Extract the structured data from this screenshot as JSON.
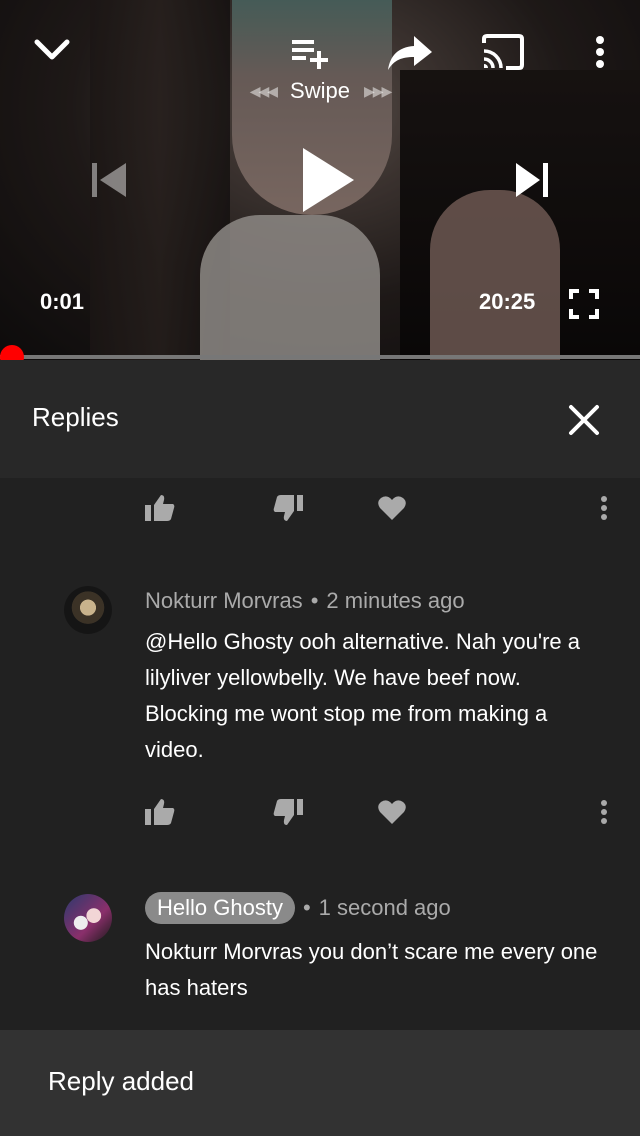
{
  "player": {
    "swipe_label": "Swipe",
    "current_time": "0:01",
    "duration": "20:25",
    "progress": 0.0008,
    "icons": [
      "chevron-down-icon",
      "add-to-queue-icon",
      "share-icon",
      "cast-icon",
      "more-vert-icon",
      "skip-previous-icon",
      "play-icon",
      "skip-next-icon",
      "fullscreen-icon"
    ]
  },
  "replies_panel": {
    "title": "Replies"
  },
  "replies": [
    {
      "author": "Nokturr Morvras",
      "separator": "•",
      "time": "2 minutes ago",
      "text": "@Hello Ghosty ooh alternative. Nah you're a lilyliver yellowbelly. We have beef now. Blocking me wont stop me from making a video."
    },
    {
      "author": "Hello Ghosty",
      "separator": "•",
      "time": "1 second ago",
      "text": "Nokturr Morvras you don’t scare me  every one has haters"
    }
  ],
  "snackbar": {
    "message": "Reply added"
  },
  "colors": {
    "background": "#212121",
    "header": "#282828",
    "progress_accent": "#ff0000",
    "snackbar": "#323232",
    "chip": "#8a8a8a"
  }
}
